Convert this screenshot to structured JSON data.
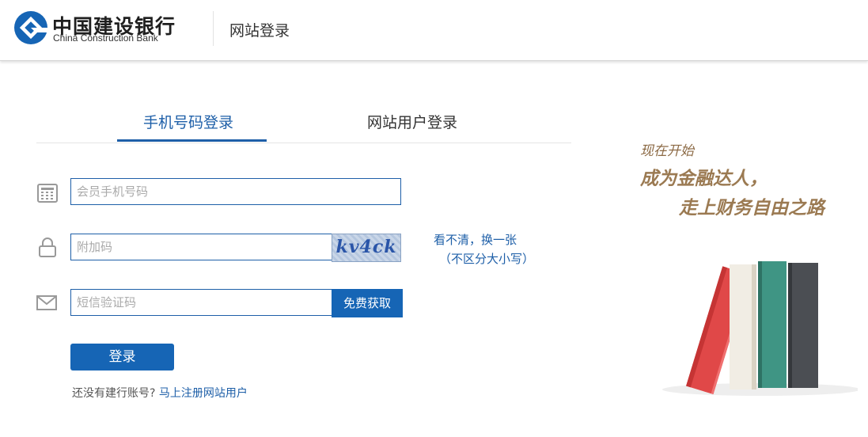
{
  "header": {
    "bank_name_cn": "中国建设银行",
    "bank_name_en": "China Construction Bank",
    "page_title": "网站登录"
  },
  "tabs": [
    {
      "label": "手机号码登录",
      "active": true
    },
    {
      "label": "网站用户登录",
      "active": false
    }
  ],
  "form": {
    "phone_placeholder": "会员手机号码",
    "captcha_placeholder": "附加码",
    "captcha_image_text": "kv4ck",
    "captcha_refresh": "看不清，换一张",
    "captcha_hint": "（不区分大小写）",
    "sms_placeholder": "短信验证码",
    "sms_button": "免费获取",
    "login_button": "登录",
    "register_question": "还没有建行账号?",
    "register_link": "马上注册网站用户"
  },
  "promo": {
    "line1": "现在开始",
    "line2": "成为金融达人，",
    "line3": "走上财务自由之路"
  },
  "icons": {
    "logo": "ccb-logo-icon",
    "phone": "phone-keypad-icon",
    "lock": "lock-icon",
    "mail": "mail-icon"
  },
  "colors": {
    "brand_blue": "#1665b5",
    "link_blue": "#1e5fa8",
    "promo_gold": "#9b7a52"
  }
}
